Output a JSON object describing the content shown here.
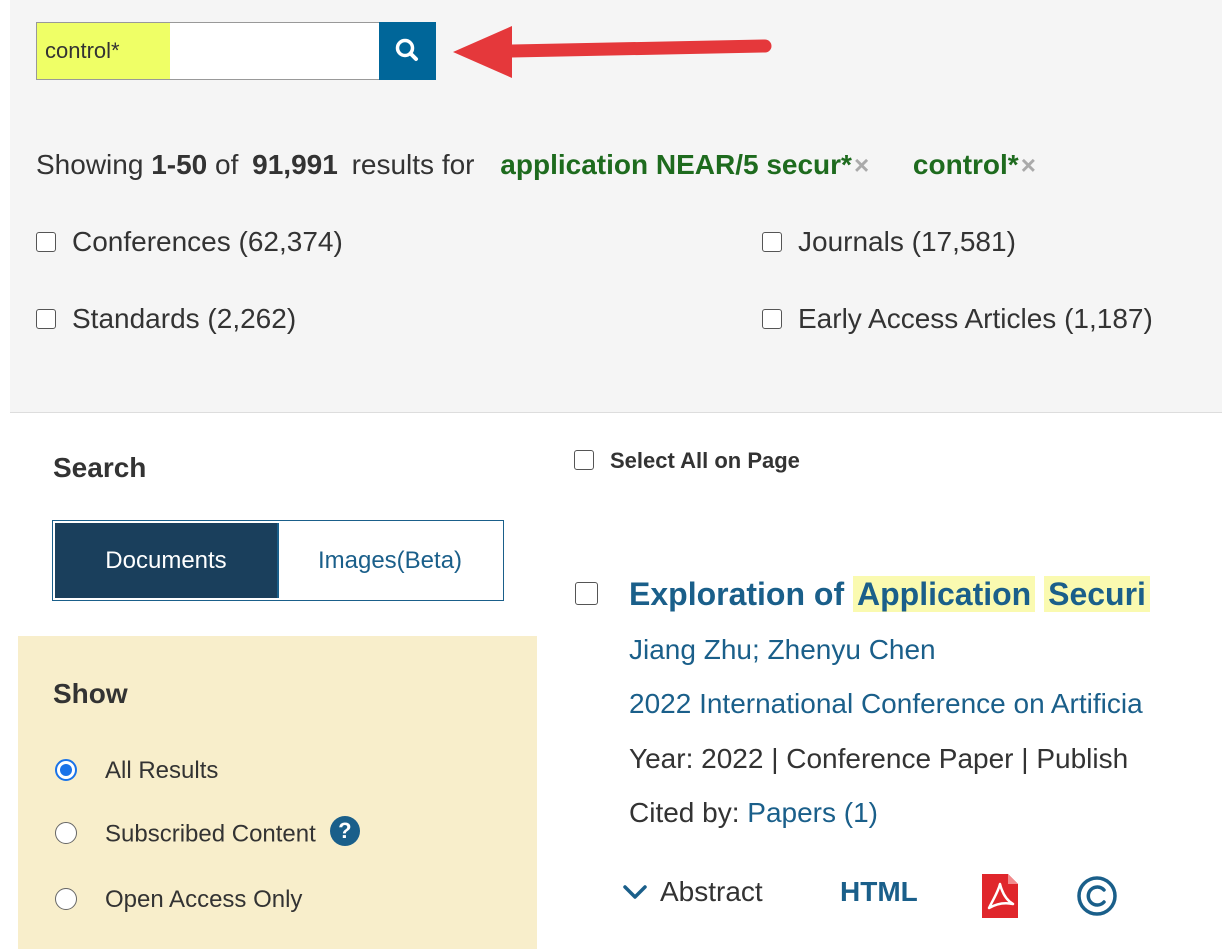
{
  "search": {
    "query": "control*",
    "placeholder": ""
  },
  "summary": {
    "prefix": "Showing",
    "range": "1-50",
    "of": "of",
    "total": "91,991",
    "results_for": "results for",
    "terms": [
      "application NEAR/5 secur*",
      "control*"
    ]
  },
  "facets": {
    "conferences": "Conferences (62,374)",
    "journals": "Journals (17,581)",
    "standards": "Standards (2,262)",
    "early_access": "Early Access Articles (1,187)"
  },
  "sidebar": {
    "search_heading": "Search",
    "tabs": [
      "Documents",
      "Images(Beta)"
    ],
    "show_heading": "Show",
    "show_options": [
      "All Results",
      "Subscribed Content",
      "Open Access Only"
    ],
    "selected_option": "All Results"
  },
  "results": {
    "select_all": "Select All on Page",
    "item": {
      "title_prefix": "Exploration of",
      "title_hl1": "Application",
      "title_hl2": "Securi",
      "authors": "Jiang Zhu; Zhenyu Chen",
      "venue": "2022 International Conference on Artificia",
      "meta": "Year: 2022  |  Conference Paper  | Publish",
      "cited_label": "Cited by:",
      "cited_link": "Papers (1)",
      "abstract": "Abstract",
      "html": "HTML"
    }
  },
  "icons": {
    "search_button": "search-icon",
    "annotation": "red-arrow-icon",
    "pdf": "pdf-icon",
    "copyright": "copyright-icon",
    "help": "help-icon"
  },
  "colors": {
    "search_highlight": "#efff66",
    "search_button": "#006699",
    "term": "#1e6b1e",
    "link": "#1a5f8a",
    "active_tab": "#1a3f5c",
    "show_panel": "#f8eecb",
    "arrow": "#e5383b"
  }
}
